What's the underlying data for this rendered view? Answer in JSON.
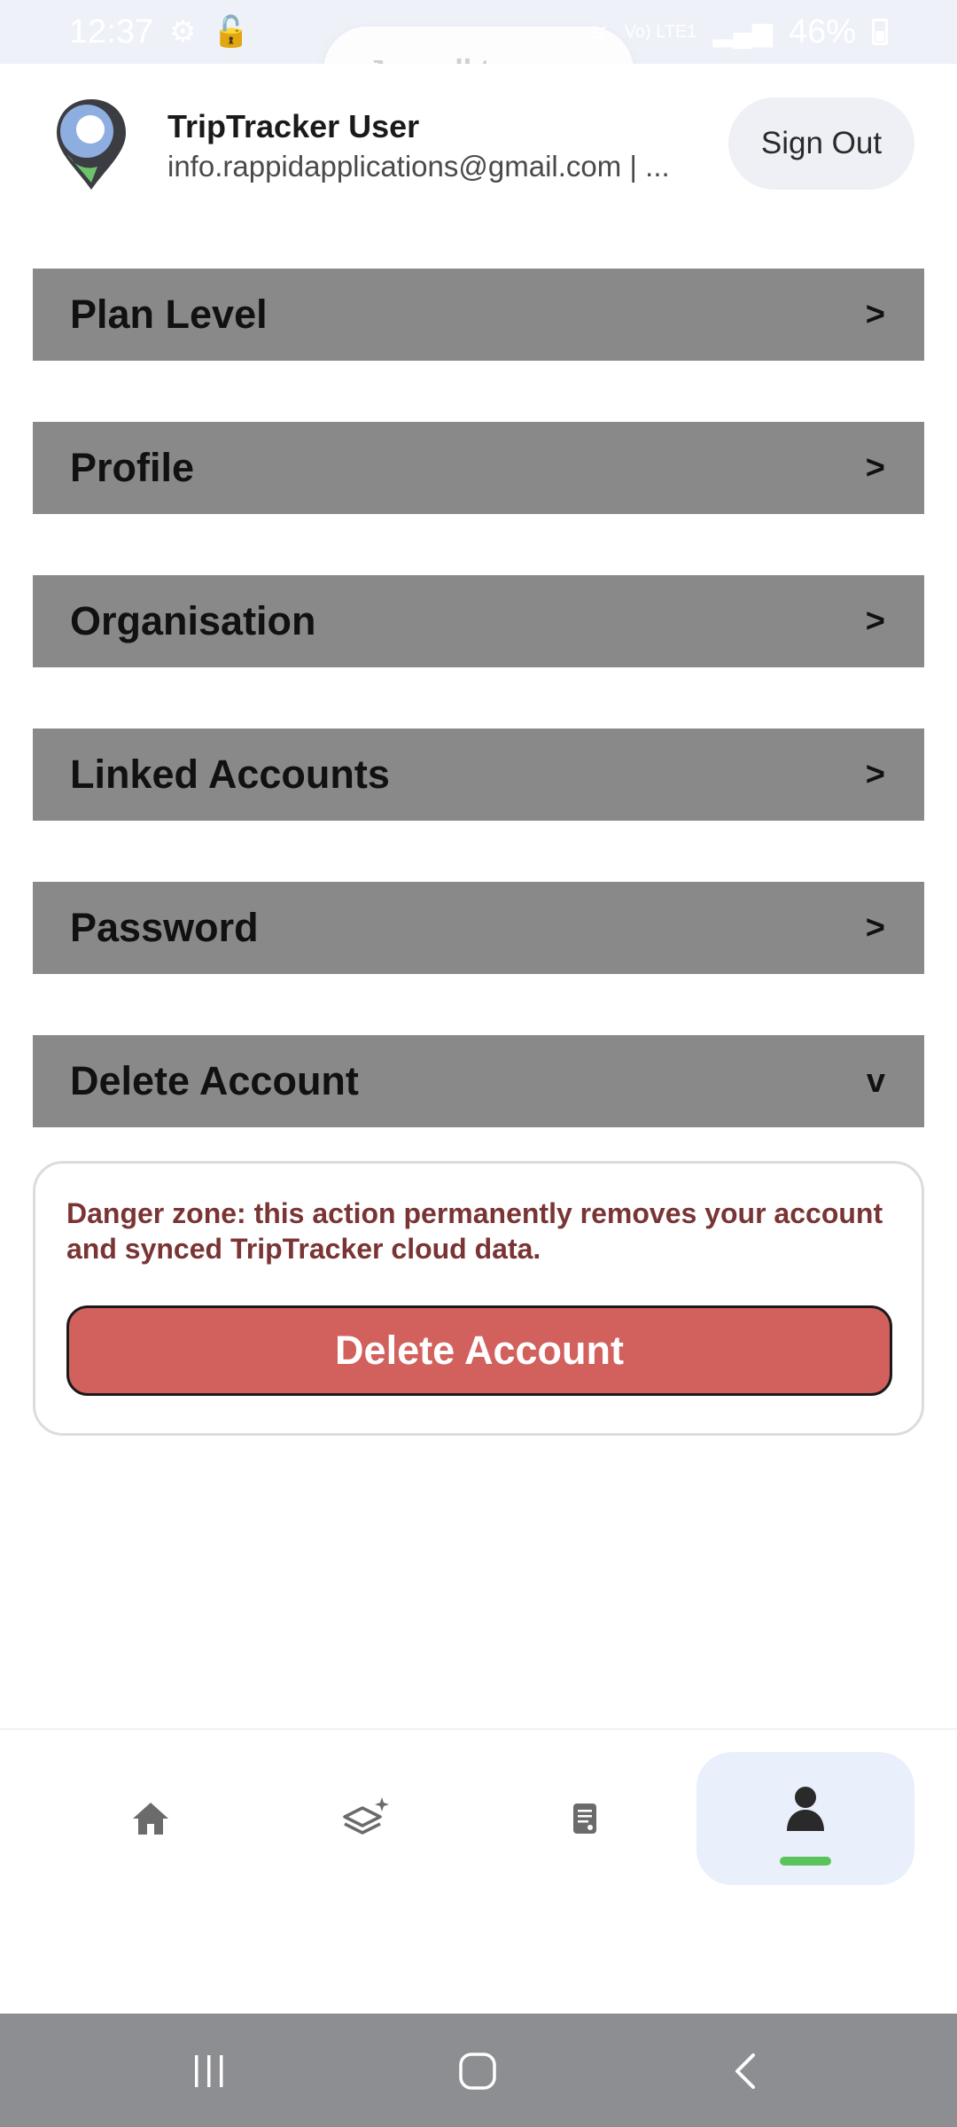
{
  "status_bar": {
    "time": "12:37",
    "battery": "46%",
    "signal_text": "Vo) LTE1"
  },
  "sync": {
    "label": "pull to sync"
  },
  "header": {
    "user_name": "TripTracker User",
    "user_email": "info.rappidapplications@gmail.com | ...",
    "sign_out_label": "Sign Out"
  },
  "sections": [
    {
      "label": "Plan Level",
      "chevron": ">"
    },
    {
      "label": "Profile",
      "chevron": ">"
    },
    {
      "label": "Organisation",
      "chevron": ">"
    },
    {
      "label": "Linked Accounts",
      "chevron": ">"
    },
    {
      "label": "Password",
      "chevron": ">"
    },
    {
      "label": "Delete Account",
      "chevron": "v"
    }
  ],
  "danger": {
    "text": "Danger zone: this action permanently removes your account and synced TripTracker cloud data.",
    "button_label": "Delete Account"
  },
  "bottom_nav": {
    "items": [
      {
        "icon": "home-icon",
        "active": false
      },
      {
        "icon": "layers-sparkle-icon",
        "active": false
      },
      {
        "icon": "document-icon",
        "active": false
      },
      {
        "icon": "person-icon",
        "active": true
      }
    ]
  },
  "colors": {
    "section_bg": "#898989",
    "danger_text": "#7a3434",
    "delete_button": "#d2605d",
    "active_nav_bg": "#e9effb",
    "active_indicator": "#5bc35b",
    "system_nav": "#8c8e91"
  }
}
